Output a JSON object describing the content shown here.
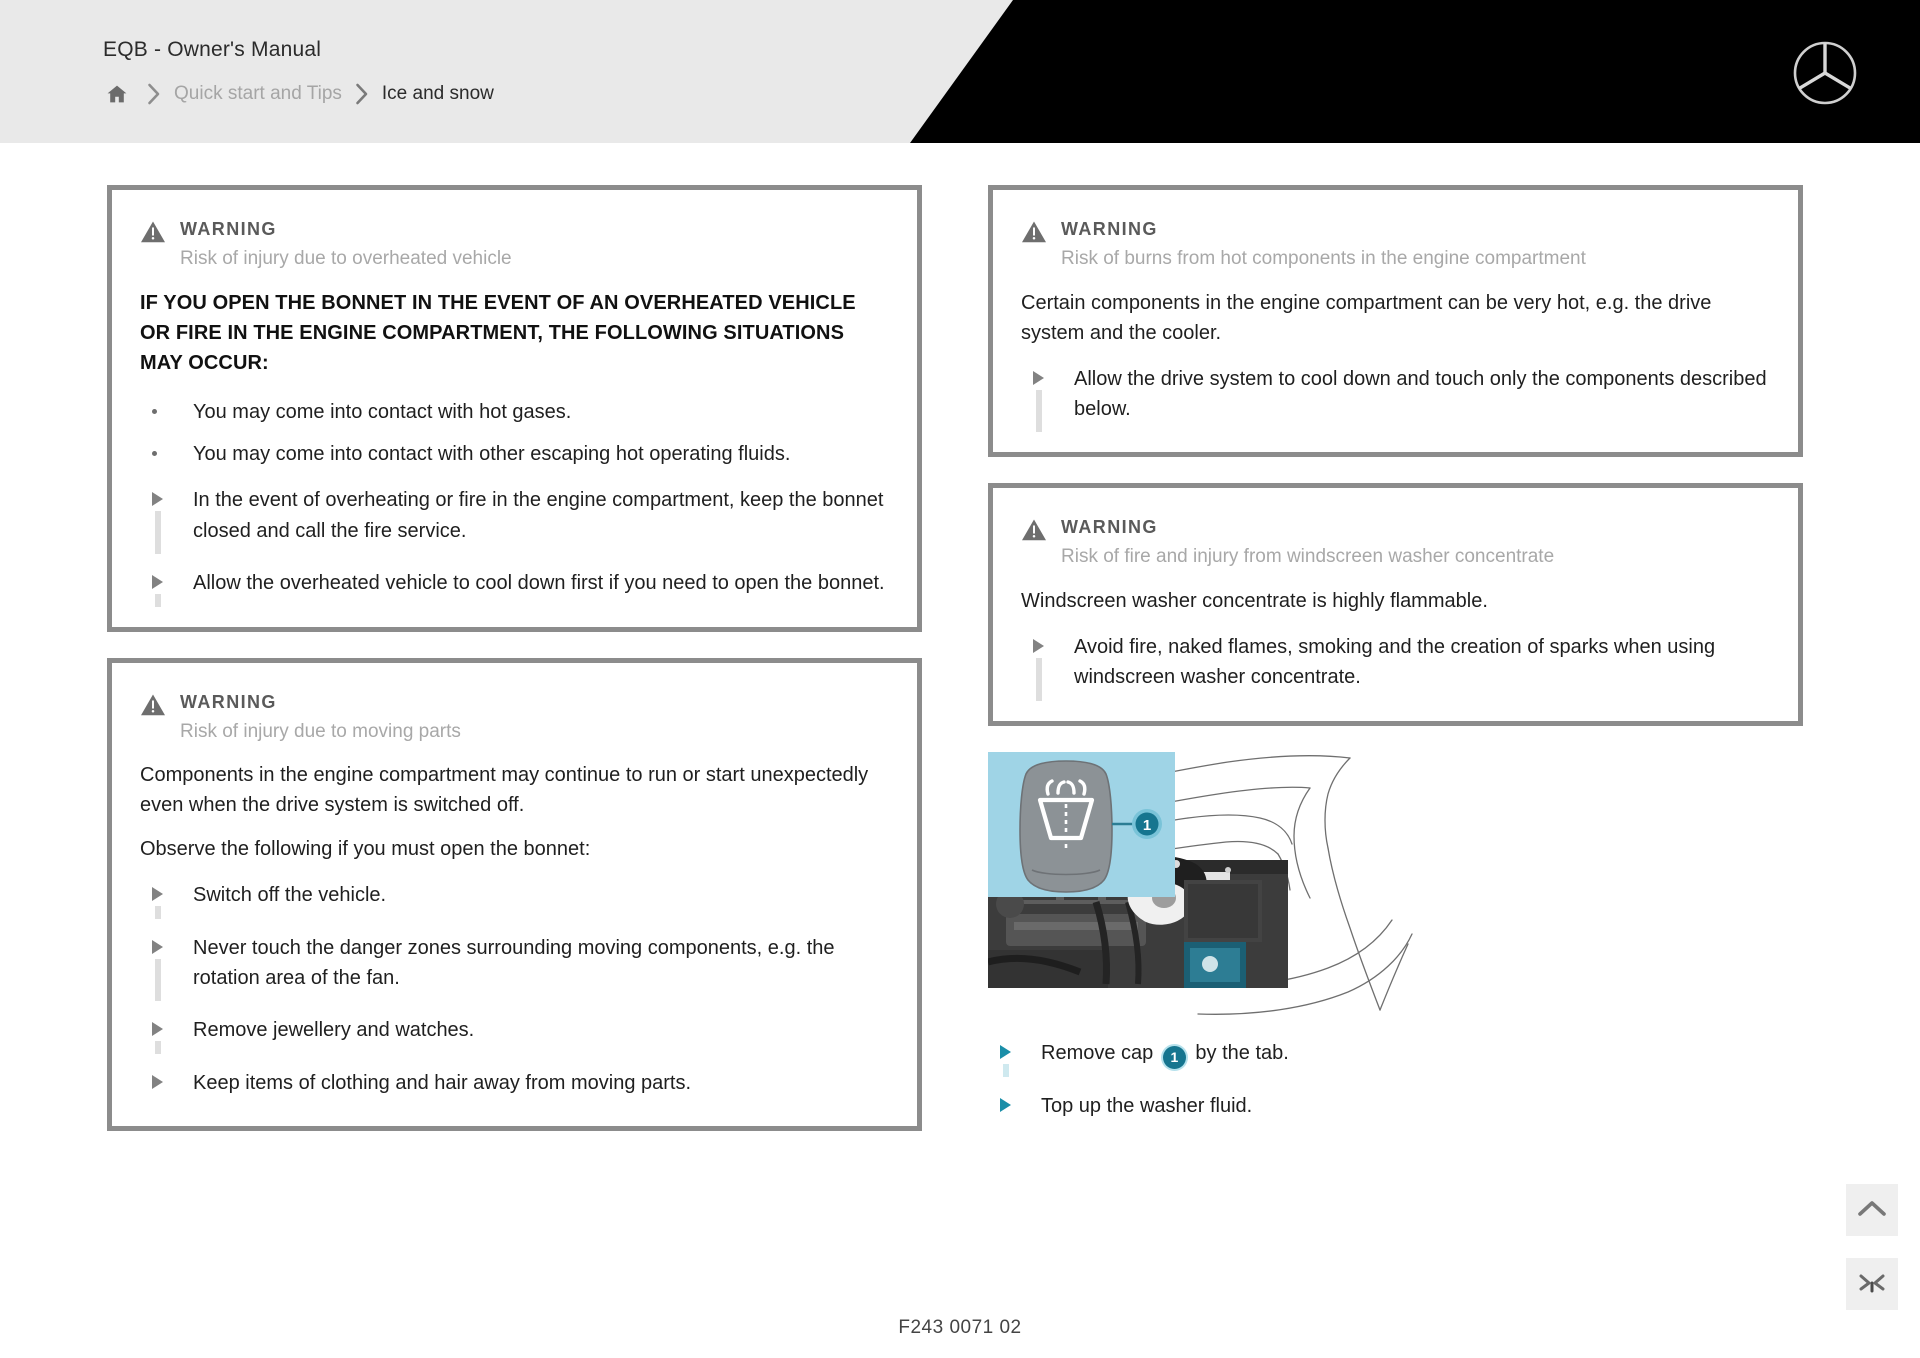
{
  "header": {
    "title": "EQB - Owner's Manual",
    "logo_name": "mercedes-benz-star-logo",
    "breadcrumb": {
      "home_icon": "home-icon",
      "separator_icon": "chevron-right-icon",
      "parent": "Quick start and Tips",
      "current": "Ice and snow"
    }
  },
  "warnings": {
    "overheated_vehicle": {
      "icon": "warning-triangle-icon",
      "label": "WARNING",
      "subtitle": "Risk of injury due to overheated vehicle",
      "headline": "IF YOU OPEN THE BONNET IN THE EVENT OF AN OVERHEATED VEHICLE OR FIRE IN THE ENGINE COMPARTMENT, THE FOLLOWING SITUATIONS MAY OCCUR:",
      "bullets": [
        "You may come into contact with hot gases.",
        "You may come into contact with other escaping hot operating fluids."
      ],
      "steps": [
        "In the event of overheating or fire in the engine compartment, keep the bonnet closed and call the fire service.",
        "Allow the overheated vehicle to cool down first if you need to open the bonnet."
      ]
    },
    "moving_parts": {
      "icon": "warning-triangle-icon",
      "label": "WARNING",
      "subtitle": "Risk of injury due to moving parts",
      "paragraphs": [
        "Components in the engine compartment may continue to run or start unexpectedly even when the drive system is switched off.",
        "Observe the following if you must open the bonnet:"
      ],
      "steps": [
        "Switch off the vehicle.",
        "Never touch the danger zones surrounding moving components, e.g. the rotation area of the fan.",
        "Remove jewellery and watches.",
        "Keep items of clothing and hair away from moving parts."
      ]
    },
    "hot_components": {
      "icon": "warning-triangle-icon",
      "label": "WARNING",
      "subtitle": "Risk of burns from hot components in the engine compartment",
      "paragraphs": [
        "Certain components in the engine compartment can be very hot, e.g. the drive system and the cooler."
      ],
      "steps": [
        "Allow the drive system to cool down and touch only the components described below."
      ]
    },
    "washer_concentrate": {
      "icon": "warning-triangle-icon",
      "label": "WARNING",
      "subtitle": "Risk of fire and injury from windscreen washer concentrate",
      "paragraphs": [
        "Windscreen washer concentrate is highly flammable."
      ],
      "steps": [
        "Avoid fire, naked flames, smoking and the creation of sparks when using windscreen washer concentrate."
      ]
    }
  },
  "illustration": {
    "name": "engine-compartment-washer-reservoir-illustration",
    "inset_icon": "windscreen-washer-symbol-icon",
    "callout_number": "1",
    "panel_color": "#9fd4e6",
    "callout_color": "#16758f"
  },
  "procedure": {
    "steps": [
      {
        "before": "Remove cap",
        "callout": "1",
        "after": "by the tab."
      },
      {
        "before": "Top up the washer fluid.",
        "callout": "",
        "after": ""
      }
    ]
  },
  "footer": {
    "code": "F243 0071 02"
  },
  "floating_buttons": {
    "scroll_top": {
      "icon": "chevron-up-icon",
      "name": "scroll-to-top-button"
    },
    "collapse": {
      "icon": "collapse-icon",
      "name": "collapse-button"
    }
  }
}
